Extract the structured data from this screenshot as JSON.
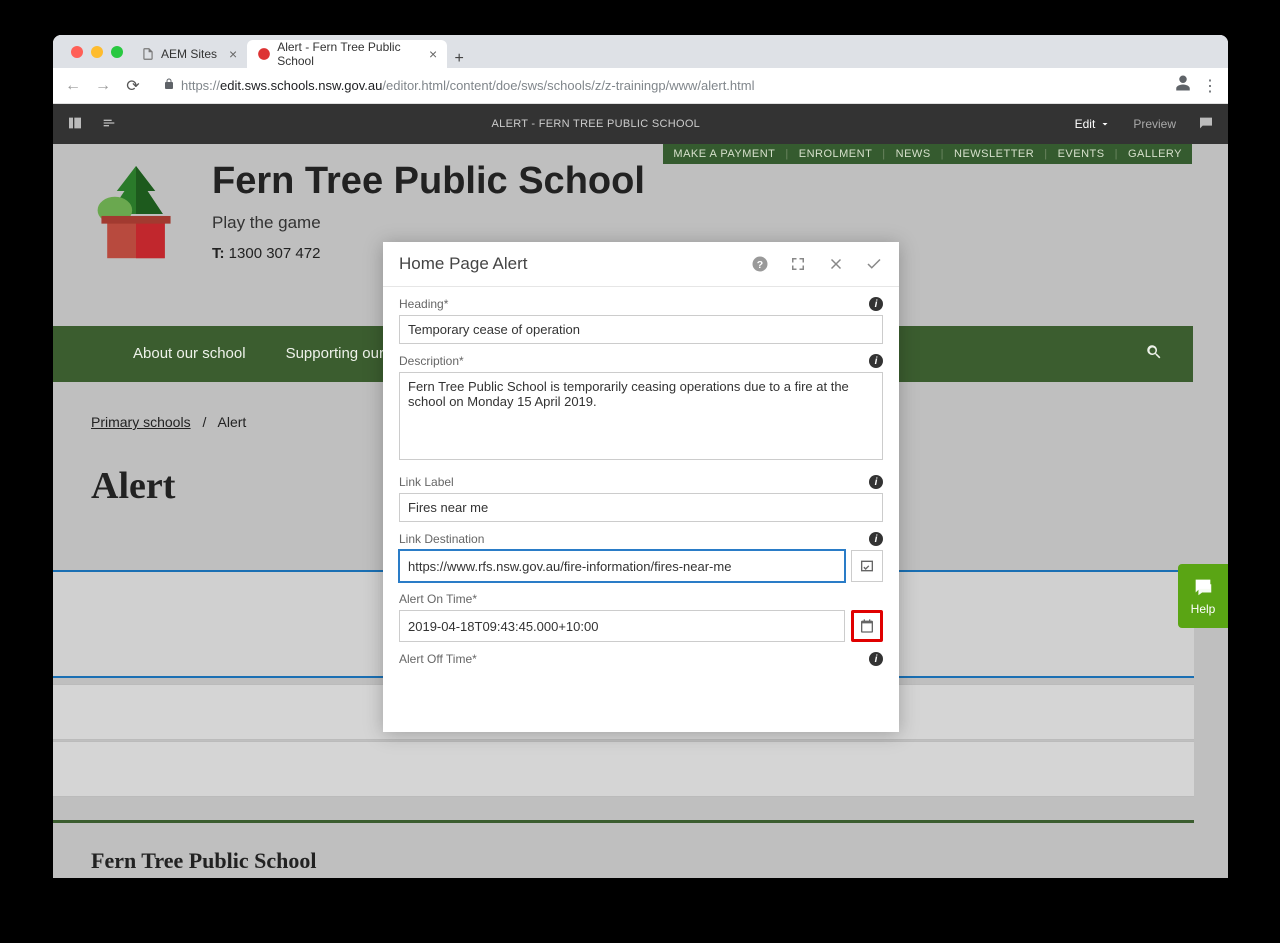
{
  "browser": {
    "tabs": [
      {
        "label": "AEM Sites"
      },
      {
        "label": "Alert - Fern Tree Public School"
      }
    ],
    "url_prefix": "https://",
    "url_host": "edit.sws.schools.nsw.gov.au",
    "url_path": "/editor.html/content/doe/sws/schools/z/z-trainingp/www/alert.html"
  },
  "aem": {
    "title": "ALERT - FERN TREE PUBLIC SCHOOL",
    "edit": "Edit",
    "preview": "Preview"
  },
  "utilbar": {
    "items": [
      "MAKE A PAYMENT",
      "ENROLMENT",
      "NEWS",
      "NEWSLETTER",
      "EVENTS",
      "GALLERY"
    ]
  },
  "site": {
    "name": "Fern Tree Public School",
    "tagline": "Play the game",
    "tel_label": "T:",
    "tel": "1300 307 472"
  },
  "nav": {
    "about": "About our school",
    "supporting": "Supporting our students"
  },
  "crumb": {
    "root": "Primary schools",
    "current": "Alert"
  },
  "page_title": "Alert",
  "footer_name": "Fern Tree Public School",
  "help_label": "Help",
  "dialog": {
    "title": "Home Page Alert",
    "fields": {
      "heading": {
        "label": "Heading*",
        "value": "Temporary cease of operation"
      },
      "description": {
        "label": "Description*",
        "value": "Fern Tree Public School is temporarily ceasing operations due to a fire at the school on Monday 15 April 2019."
      },
      "link_label": {
        "label": "Link Label",
        "value": "Fires near me"
      },
      "link_dest": {
        "label": "Link Destination",
        "value": "https://www.rfs.nsw.gov.au/fire-information/fires-near-me"
      },
      "on_time": {
        "label": "Alert On Time*",
        "value": "2019-04-18T09:43:45.000+10:00"
      },
      "off_time": {
        "label": "Alert Off Time*",
        "value": ""
      }
    }
  }
}
